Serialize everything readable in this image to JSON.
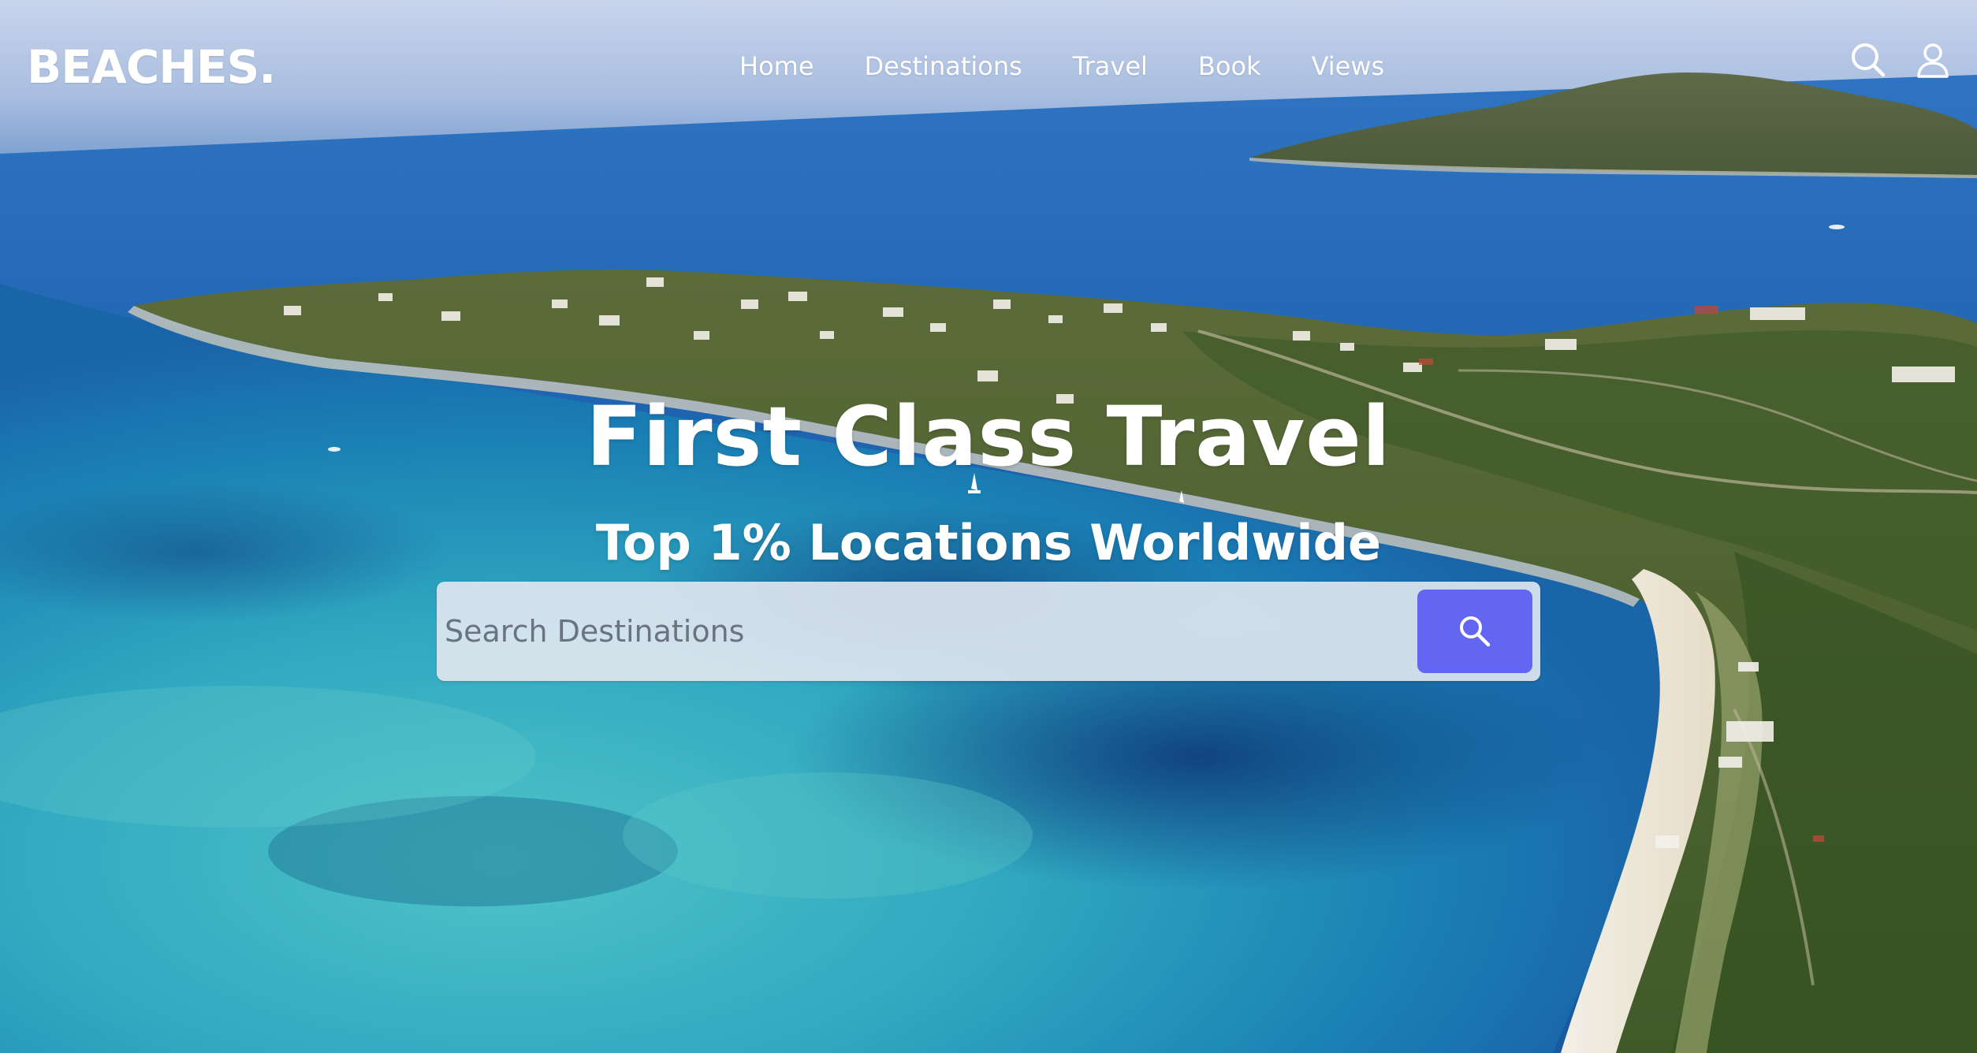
{
  "brand": {
    "logo_text": "BEACHES."
  },
  "nav": {
    "items": [
      {
        "label": "Home"
      },
      {
        "label": "Destinations"
      },
      {
        "label": "Travel"
      },
      {
        "label": "Book"
      },
      {
        "label": "Views"
      }
    ]
  },
  "header_icons": {
    "search": "search-icon",
    "user": "user-icon"
  },
  "hero": {
    "title": "First Class Travel",
    "subtitle": "Top 1% Locations Worldwide"
  },
  "search": {
    "placeholder": "Search Destinations",
    "value": "",
    "button_icon": "search-icon"
  },
  "colors": {
    "accent": "#6366f1",
    "text_light": "#ffffff",
    "search_bg": "#e2e8f0",
    "sea_deep": "#1a5fa0",
    "lagoon": "#36b5c2"
  }
}
